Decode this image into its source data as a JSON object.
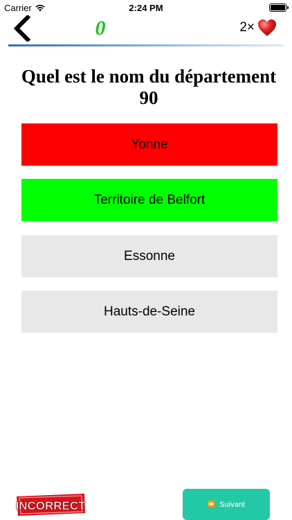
{
  "status_bar": {
    "carrier": "Carrier",
    "time": "2:24 PM"
  },
  "header": {
    "back_icon": "chevron-left-icon",
    "score": "0",
    "lives": "2×",
    "heart_icon": "heart-icon",
    "score_color": "#22c322"
  },
  "question": {
    "text": "Quel est le nom du département 90"
  },
  "answers": [
    {
      "label": "Yonne",
      "state": "wrong",
      "color": "#ff0000"
    },
    {
      "label": "Territoire de Belfort",
      "state": "correct",
      "color": "#00ff00"
    },
    {
      "label": "Essonne",
      "state": "neutral",
      "color": "#e8e8e8"
    },
    {
      "label": "Hauts-de-Seine",
      "state": "neutral",
      "color": "#e8e8e8"
    }
  ],
  "footer": {
    "result_badge": "INCORRECT",
    "next_label": "Suivant",
    "next_icon": "fast-forward-icon",
    "next_color": "#23c9a6"
  }
}
